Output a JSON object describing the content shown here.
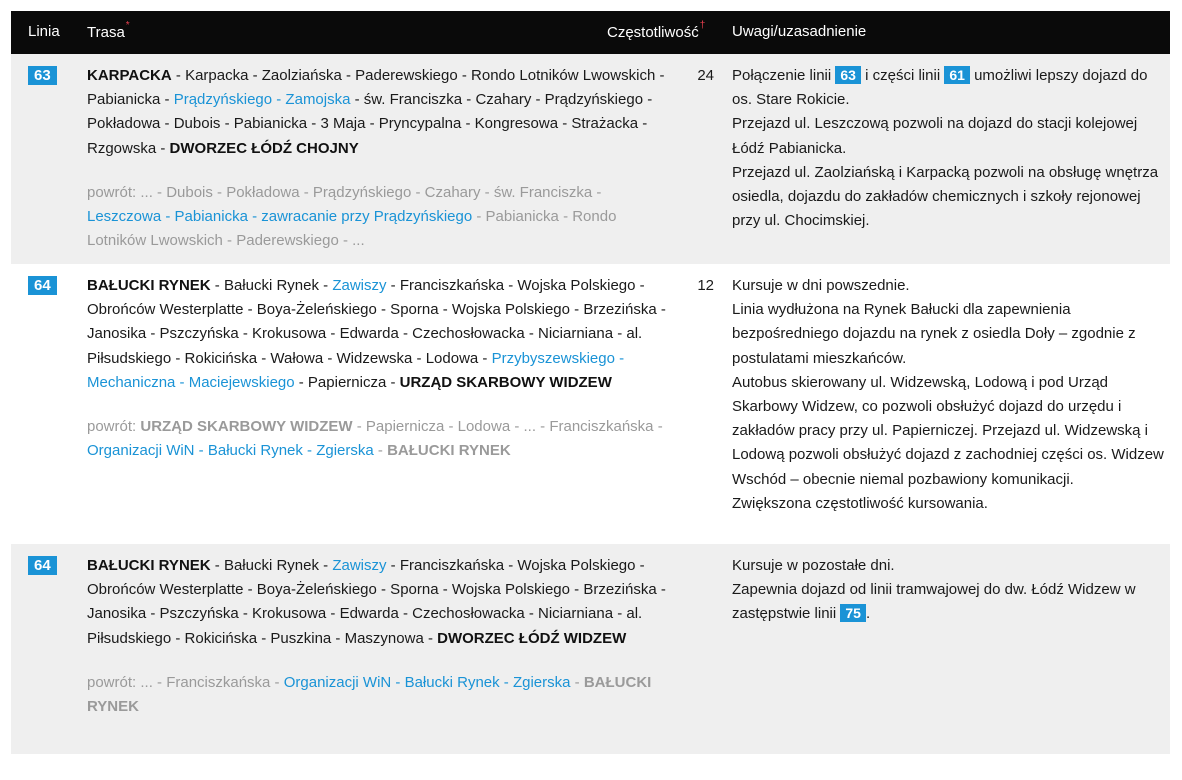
{
  "header": {
    "col_line": "Linia",
    "col_route": "Trasa",
    "col_route_mark": "*",
    "col_freq": "Częstotliwość",
    "col_freq_mark": "†",
    "col_notes": "Uwagi/uzasadnienie"
  },
  "colors": {
    "accent": "#1a93d6",
    "header_bg": "#0a0a0a",
    "shade": "#efefef",
    "muted": "#9a9a9a"
  },
  "rows": [
    {
      "line": "63",
      "shaded": true,
      "route": [
        {
          "t": "KARPACKA",
          "s": "k"
        },
        {
          "t": " - Karpacka - Zaolziańska - Paderewskiego - Rondo Lotników Lwowskich - Pabianicka - ",
          "s": ""
        },
        {
          "t": "Prądzyńskiego - Zamojska",
          "s": "b"
        },
        {
          "t": " - św. Franciszka - Czahary - Prądzyńskiego - Pokładowa - Dubois - Pabianicka - 3 Maja - Pryncypalna - Kongresowa - Strażacka - Rzgowska - ",
          "s": ""
        },
        {
          "t": "DWORZEC ŁÓDŹ CHOJNY",
          "s": "k"
        }
      ],
      "return": [
        {
          "t": "powrót: ... - Dubois - Pokładowa - Prądzyńskiego - Czahary - św. Franciszka - ",
          "s": "g"
        },
        {
          "t": "Leszczowa - Pabianicka - zawracanie przy Prądzyńskiego",
          "s": "gl"
        },
        {
          "t": " - Pabianicka - Rondo Lotników Lwowskich - Paderewskiego - ...",
          "s": "g"
        }
      ],
      "freq": "24",
      "notes": [
        [
          {
            "t": "Połączenie linii "
          },
          {
            "badge": "63"
          },
          {
            "t": " i części linii "
          },
          {
            "badge": "61"
          },
          {
            "t": " umożliwi lepszy dojazd do os. Stare Rokicie."
          }
        ],
        [
          {
            "t": "Przejazd ul. Leszczową pozwoli na dojazd do stacji kolejowej Łódź Pabianicka."
          }
        ],
        [
          {
            "t": "Przejazd ul. Zaolziańską i Karpacką pozwoli na obsługę wnętrza osiedla, dojazdu do zakładów chemicznych i szkoły rejonowej przy ul. Chocimskiej."
          }
        ]
      ]
    },
    {
      "line": "64",
      "shaded": false,
      "route": [
        {
          "t": "BAŁUCKI RYNEK",
          "s": "k"
        },
        {
          "t": " - Bałucki Rynek - ",
          "s": ""
        },
        {
          "t": "Zawiszy",
          "s": "b"
        },
        {
          "t": " - Franciszkańska - Wojska Polskiego - Obrońców Westerplatte - Boya-Żeleńskiego - Sporna - Wojska Polskiego - Brzezińska - Janosika - Pszczyńska - Krokusowa - Edwarda - Czechosłowacka - Niciarniana - al. Piłsudskiego - Rokicińska - Wałowa - Widzewska - Lodowa - ",
          "s": ""
        },
        {
          "t": "Przybyszewskiego - Mechaniczna - Maciejewskiego",
          "s": "b"
        },
        {
          "t": " - Papiernicza - ",
          "s": ""
        },
        {
          "t": "URZĄD SKARBOWY WIDZEW",
          "s": "k"
        }
      ],
      "return": [
        {
          "t": "powrót: ",
          "s": "g"
        },
        {
          "t": "URZĄD SKARBOWY WIDZEW",
          "s": "gb"
        },
        {
          "t": " - Papiernicza - Lodowa - ... - Franciszkańska - ",
          "s": "g"
        },
        {
          "t": "Organizacji WiN - Bałucki Rynek - Zgierska",
          "s": "gl"
        },
        {
          "t": " - ",
          "s": "g"
        },
        {
          "t": "BAŁUCKI RYNEK",
          "s": "gb"
        }
      ],
      "freq": "12",
      "notes": [
        [
          {
            "t": "Kursuje w dni powszednie."
          }
        ],
        [
          {
            "t": "Linia wydłużona na Rynek Bałucki dla zapewnienia bezpośredniego dojazdu na rynek z osiedla Doły – zgodnie z postulatami mieszkańców."
          }
        ],
        [
          {
            "t": "Autobus skierowany ul. Widzewską, Lodową i pod Urząd Skarbowy Widzew, co pozwoli obsłużyć dojazd do urzędu i zakładów pracy przy ul. Papierniczej. Przejazd ul. Widzewską i Lodową pozwoli obsłużyć dojazd z zachodniej części os. Widzew Wschód – obecnie niemal pozbawiony komunikacji."
          }
        ],
        [
          {
            "t": "Zwiększona częstotliwość kursowania."
          }
        ]
      ]
    },
    {
      "line": "64",
      "shaded": true,
      "route": [
        {
          "t": "BAŁUCKI RYNEK",
          "s": "k"
        },
        {
          "t": " - Bałucki Rynek - ",
          "s": ""
        },
        {
          "t": "Zawiszy",
          "s": "b"
        },
        {
          "t": " - Franciszkańska - Wojska Polskiego - Obrońców Westerplatte - Boya-Żeleńskiego - Sporna - Wojska Polskiego - Brzezińska - Janosika - Pszczyńska - Krokusowa - Edwarda - Czechosłowacka - Niciarniana - al. Piłsudskiego - Rokicińska - Puszkina - Maszynowa - ",
          "s": ""
        },
        {
          "t": "DWORZEC ŁÓDŹ WIDZEW",
          "s": "k"
        }
      ],
      "return": [
        {
          "t": "powrót: ... - Franciszkańska - ",
          "s": "g"
        },
        {
          "t": "Organizacji WiN - Bałucki Rynek - Zgierska",
          "s": "gl"
        },
        {
          "t": " - ",
          "s": "g"
        },
        {
          "t": "BAŁUCKI RYNEK",
          "s": "gb"
        }
      ],
      "freq": "",
      "notes": [
        [
          {
            "t": "Kursuje w pozostałe dni."
          }
        ],
        [
          {
            "t": "Zapewnia dojazd od linii tramwajowej do dw. Łódź Widzew w zastępstwie linii "
          },
          {
            "badge": "75"
          },
          {
            "t": "."
          }
        ]
      ]
    }
  ]
}
